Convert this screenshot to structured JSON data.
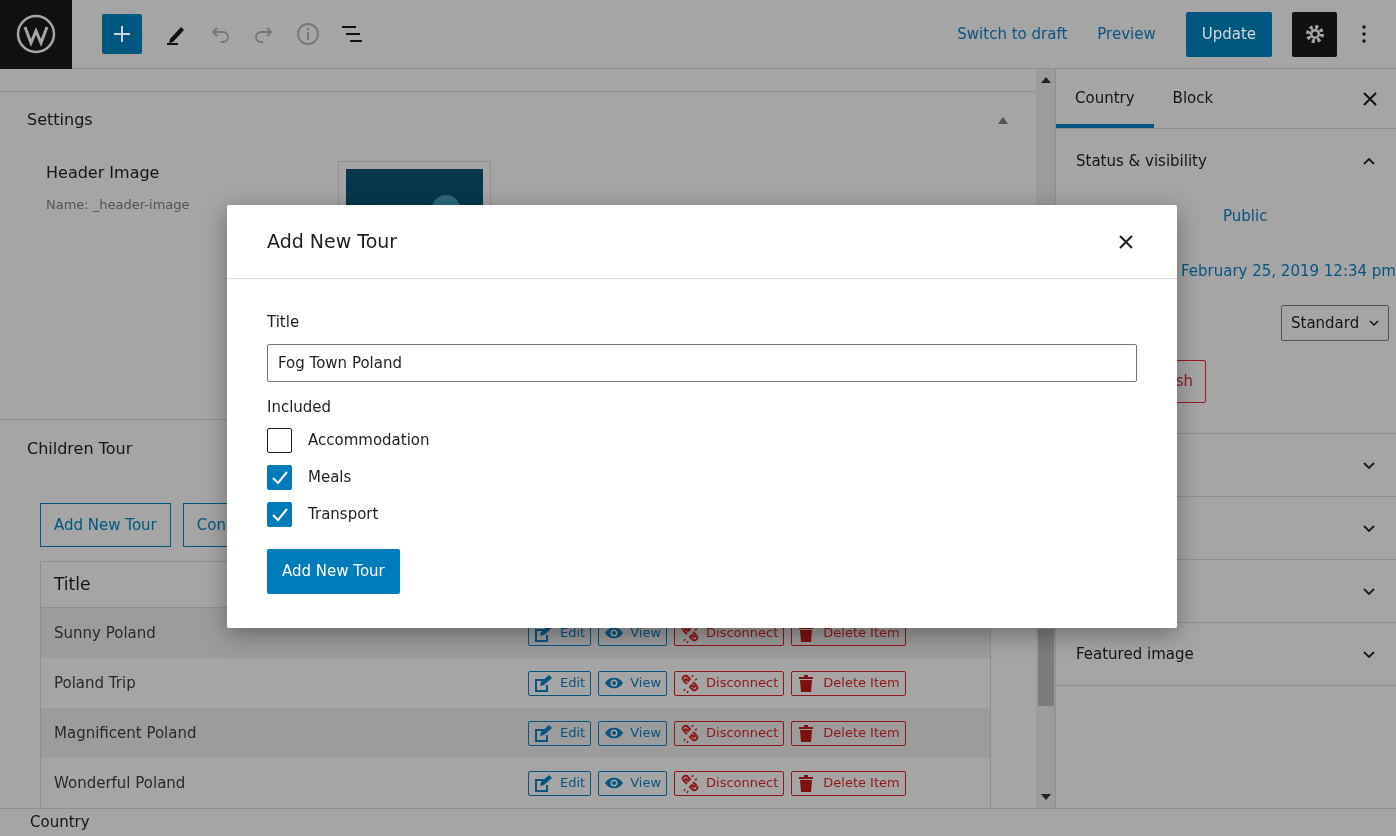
{
  "toolbar": {
    "links": [
      "Switch to draft",
      "Preview"
    ],
    "primary": "Update"
  },
  "settings_panel": {
    "title": "Settings",
    "expanded": true,
    "field_label": "Header Image",
    "field_name": "Name: _header-image"
  },
  "children_panel": {
    "title": "Children Tour",
    "buttons": [
      "Add New Tour",
      "Con"
    ],
    "table": {
      "columns": [
        "Title"
      ],
      "rows": [
        {
          "title": "Sunny Poland",
          "actions": [
            {
              "kind": "edit",
              "label": "Edit"
            },
            {
              "kind": "view",
              "label": "View"
            },
            {
              "kind": "disconnect",
              "label": "Disconnect"
            },
            {
              "kind": "delete",
              "label": "Delete Item"
            }
          ]
        },
        {
          "title": "Poland Trip",
          "actions": [
            {
              "kind": "edit",
              "label": "Edit"
            },
            {
              "kind": "view",
              "label": "View"
            },
            {
              "kind": "disconnect",
              "label": "Disconnect"
            },
            {
              "kind": "delete",
              "label": "Delete Item"
            }
          ]
        },
        {
          "title": "Magnificent Poland",
          "actions": [
            {
              "kind": "edit",
              "label": "Edit"
            },
            {
              "kind": "view",
              "label": "View"
            },
            {
              "kind": "disconnect",
              "label": "Disconnect"
            },
            {
              "kind": "delete",
              "label": "Delete Item"
            }
          ]
        },
        {
          "title": "Wonderful Poland",
          "actions": [
            {
              "kind": "edit",
              "label": "Edit"
            },
            {
              "kind": "view",
              "label": "View"
            },
            {
              "kind": "disconnect",
              "label": "Disconnect"
            },
            {
              "kind": "delete",
              "label": "Delete Item"
            }
          ]
        }
      ]
    }
  },
  "sidebar": {
    "tabs": [
      {
        "label": "Country",
        "selected": true
      },
      {
        "label": "Block",
        "selected": false
      }
    ],
    "status_panel": {
      "title": "Status & visibility",
      "expanded": true,
      "visibility": "Public",
      "publish_date": "February 25, 2019 12:34 pm",
      "format": "Standard",
      "trash_button": "sh"
    },
    "panels": [
      {
        "expanded": false
      },
      {
        "expanded": false
      },
      {
        "expanded": false
      },
      {
        "title": "Featured image",
        "expanded": false
      }
    ]
  },
  "status_bar": "Country",
  "modal": {
    "title": "Add New Tour",
    "title_label": "Title",
    "title_value": "Fog Town Poland",
    "included_label": "Included",
    "options": [
      {
        "label": "Accommodation",
        "checked": false
      },
      {
        "label": "Meals",
        "checked": true
      },
      {
        "label": "Transport",
        "checked": true
      }
    ],
    "submit": "Add New Tour"
  }
}
